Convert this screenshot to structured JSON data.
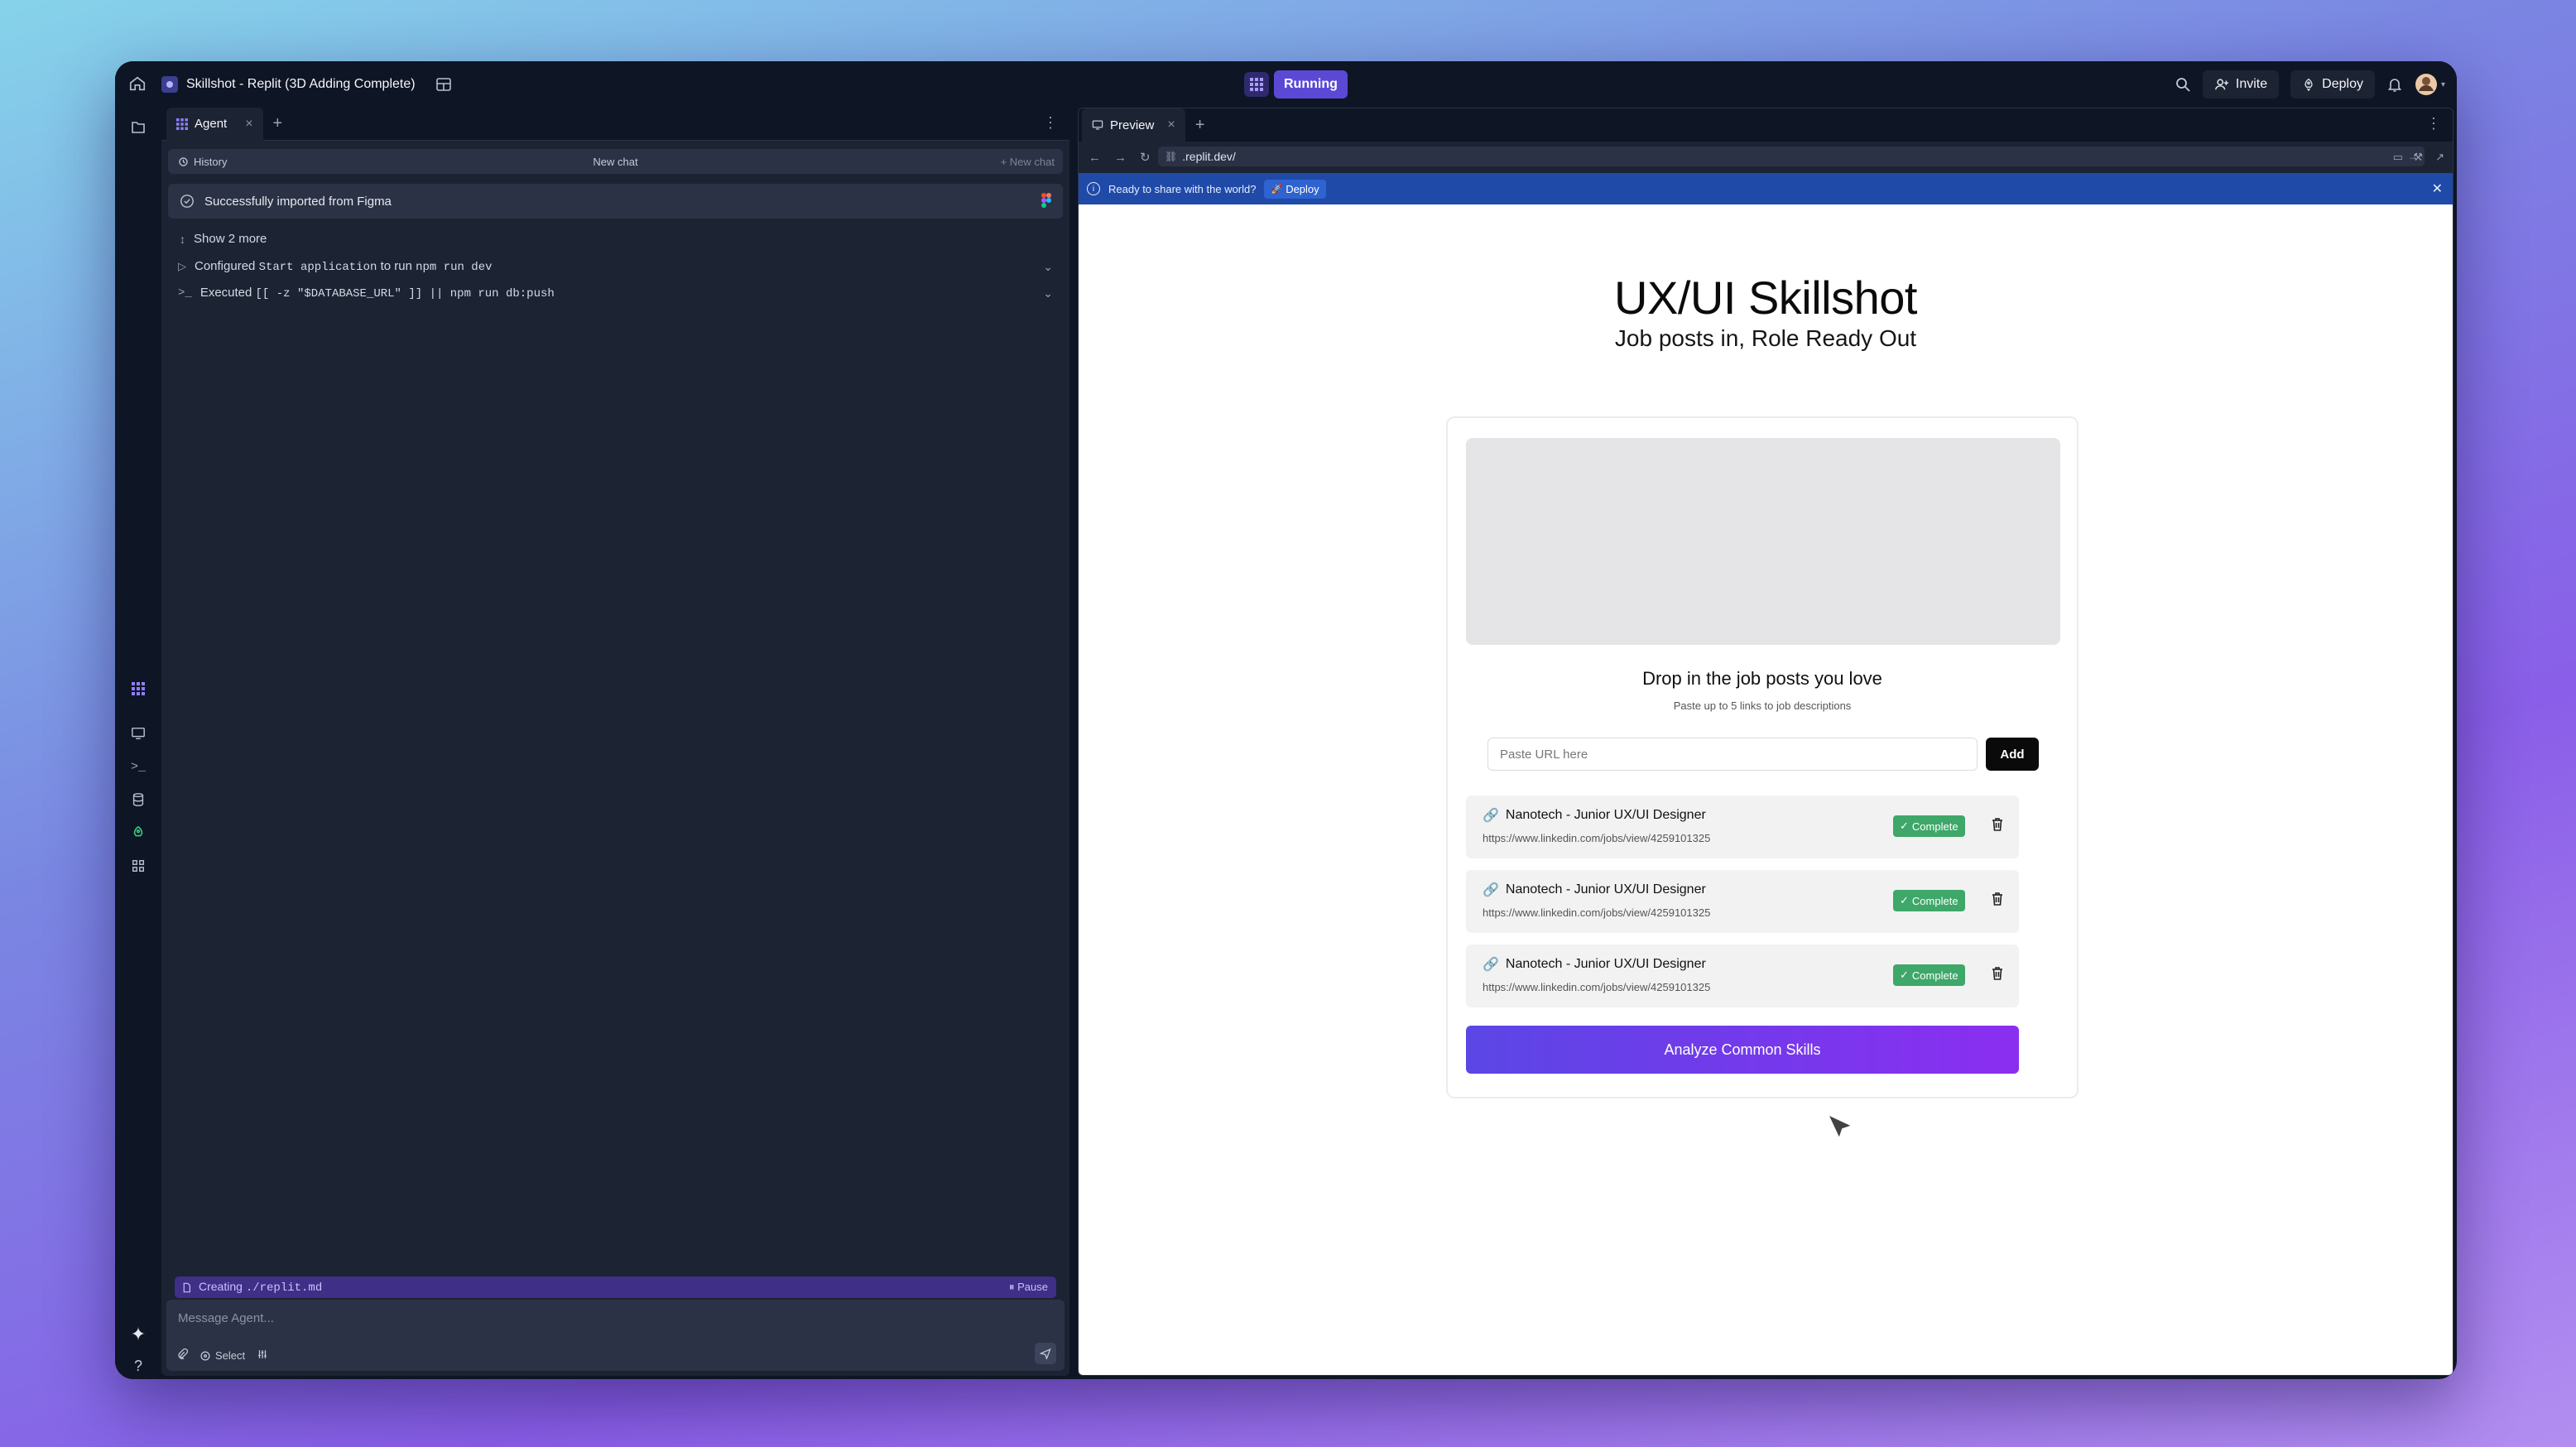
{
  "topbar": {
    "title": "Skillshot - Replit (3D Adding Complete)",
    "status": "Running",
    "invite": "Invite",
    "deploy": "Deploy"
  },
  "agent": {
    "tab_label": "Agent",
    "history": "History",
    "new_chat_center": "New chat",
    "new_chat_right": "New chat",
    "imported": "Successfully imported from Figma",
    "show_more": "Show 2 more",
    "configured_prefix": "Configured",
    "configured_cmd1": "Start application",
    "configured_mid": "to run",
    "configured_cmd2": "npm run dev",
    "executed_prefix": "Executed",
    "executed_cmd": "[[ -z \"$DATABASE_URL\" ]] || npm run db:push",
    "creating_prefix": "Creating",
    "creating_file": "./replit.md",
    "pause": "Pause",
    "message_placeholder": "Message Agent...",
    "select": "Select"
  },
  "preview": {
    "tab_label": "Preview",
    "url": ".replit.dev/",
    "share_text": "Ready to share with the world?",
    "share_deploy": "Deploy"
  },
  "page": {
    "title": "UX/UI Skillshot",
    "subtitle": "Job posts in, Role Ready Out",
    "drop_title": "Drop in the job posts you love",
    "drop_subtitle": "Paste up to 5 links to job descriptions",
    "input_placeholder": "Paste URL here",
    "add_label": "Add",
    "items": [
      {
        "title": "Nanotech - Junior UX/UI Designer",
        "url": "https://www.linkedin.com/jobs/view/4259101325",
        "status": "Complete"
      },
      {
        "title": "Nanotech - Junior UX/UI Designer",
        "url": "https://www.linkedin.com/jobs/view/4259101325",
        "status": "Complete"
      },
      {
        "title": "Nanotech - Junior UX/UI Designer",
        "url": "https://www.linkedin.com/jobs/view/4259101325",
        "status": "Complete"
      }
    ],
    "analyze_label": "Analyze Common Skills"
  },
  "colors": {
    "accent": "#5b49d6",
    "success": "#3ea769",
    "banner": "#1f4aa8",
    "gradient_start": "#5b46e6",
    "gradient_end": "#8b2ef0"
  }
}
